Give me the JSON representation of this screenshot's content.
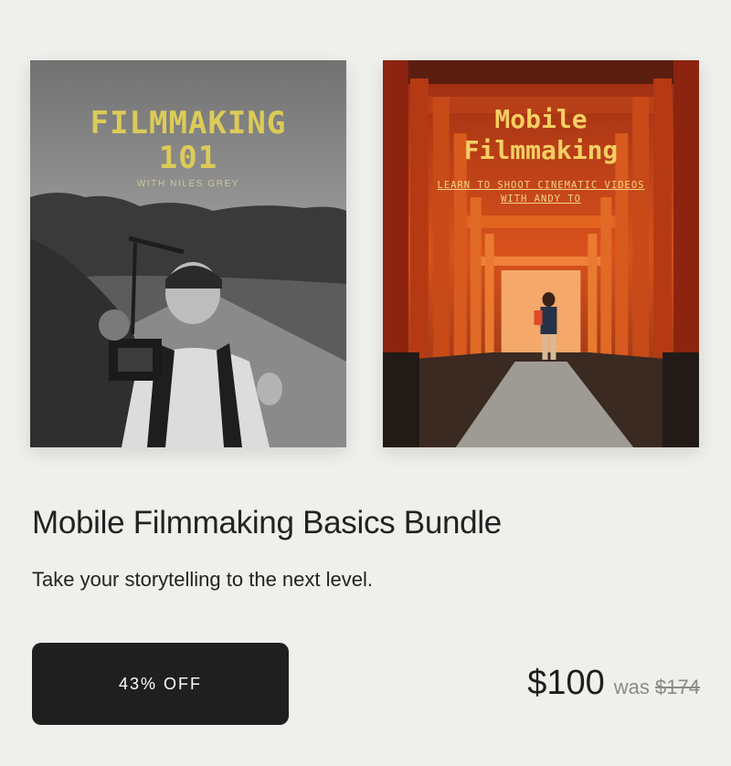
{
  "covers": [
    {
      "title_line1": "FILMMAKING",
      "title_line2": "101",
      "subtitle": "WITH NILES GREY"
    },
    {
      "title_line1": "Mobile",
      "title_line2": "Filmmaking",
      "subtitle_line1": "LEARN TO SHOOT CINEMATIC VIDEOS",
      "subtitle_line2": "WITH ANDY TO"
    }
  ],
  "product": {
    "title": "Mobile Filmmaking Basics Bundle",
    "description": "Take your storytelling to the next level."
  },
  "purchase": {
    "discount_label": "43% OFF",
    "price": "$100",
    "was_label": "was",
    "original_price": "$174"
  },
  "colors": {
    "background": "#efefec",
    "button": "#1f1f1f",
    "left_title": "#dccb57",
    "right_title": "#f6cf62"
  }
}
